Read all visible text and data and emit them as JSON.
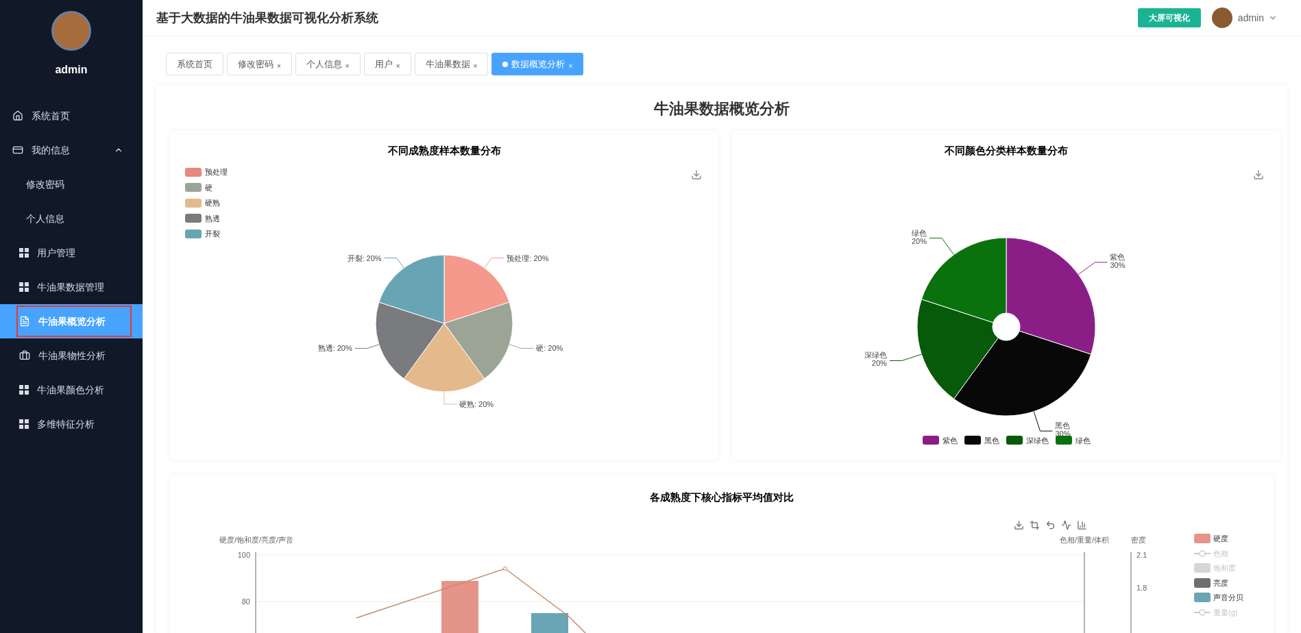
{
  "sidebar": {
    "user": "admin",
    "items": [
      {
        "label": "系统首页",
        "kind": "home",
        "selected": false
      },
      {
        "label": "我的信息",
        "kind": "wallet",
        "selected": false,
        "expanded": true,
        "children": [
          {
            "label": "修改密码",
            "selected": false
          },
          {
            "label": "个人信息",
            "selected": false
          }
        ]
      },
      {
        "label": "用户管理",
        "kind": "grid",
        "selected": false
      },
      {
        "label": "牛油果数据管理",
        "kind": "grid",
        "selected": false
      },
      {
        "label": "牛油果概览分析",
        "kind": "document",
        "selected": true
      },
      {
        "label": "牛油果物性分析",
        "kind": "briefcase",
        "selected": false
      },
      {
        "label": "牛油果颜色分析",
        "kind": "grid",
        "selected": false
      },
      {
        "label": "多维特征分析",
        "kind": "grid",
        "selected": false
      }
    ]
  },
  "header": {
    "title": "基于大数据的牛油果数据可视化分析系统",
    "screen_button": "大屏可视化",
    "user": "admin"
  },
  "tabs": [
    {
      "label": "系统首页",
      "selected": false
    },
    {
      "label": "修改密码",
      "selected": false,
      "close": "×"
    },
    {
      "label": "个人信息",
      "selected": false,
      "close": "×"
    },
    {
      "label": "用户",
      "selected": false,
      "close": "×"
    },
    {
      "label": "牛油果数据",
      "selected": false,
      "close": "×"
    },
    {
      "label": "数据概览分析",
      "selected": true,
      "close": "×"
    }
  ],
  "page_title": "牛油果数据概览分析",
  "ripeness_chart": {
    "legend": [
      {
        "label": "预处理",
        "color": "#e8877e"
      },
      {
        "label": "硬",
        "color": "#9ca595"
      },
      {
        "label": "硬熟",
        "color": "#e4b98c"
      },
      {
        "label": "熟透",
        "color": "#7a7b7f"
      },
      {
        "label": "开裂",
        "color": "#68a5b4"
      }
    ],
    "chart_data": {
      "type": "pie",
      "title": "不同成熟度样本数量分布",
      "series": [
        {
          "values": [
            20,
            20,
            20,
            20,
            20
          ]
        }
      ],
      "colors": [
        "#f4998b",
        "#9ca595",
        "#e4b98c",
        "#7a7b7f",
        "#68a5b4"
      ],
      "value_labels": [
        "预处理: 20%",
        "硬: 20%",
        "硬熟: 20%",
        "熟透: 20%",
        "开裂: 20%"
      ]
    }
  },
  "color_chart": {
    "legend": [
      {
        "label": "紫色",
        "color": "#8b1e86"
      },
      {
        "label": "黑色",
        "color": "#080808"
      },
      {
        "label": "深绿色",
        "color": "#065a0a"
      },
      {
        "label": "绿色",
        "color": "#0a720d"
      }
    ],
    "chart_data": {
      "type": "donut",
      "title": "不同颜色分类样本数量分布",
      "series": [
        {
          "values": [
            30,
            30,
            20,
            20
          ]
        }
      ],
      "colors": [
        "#8b1e86",
        "#080808",
        "#065a0a",
        "#0a720d"
      ],
      "value_labels": [
        "紫色\n30%",
        "黑色\n30%",
        "深绿色\n20%",
        "绿色\n20%"
      ]
    }
  },
  "metrics_chart": {
    "title": "各成熟度下核心指标平均值对比",
    "left_axis_name": "硬度/饱和度/亮度/声音",
    "right_axis_name": "色相/重量/体积",
    "density_axis_name": "密度",
    "left_ticks": [
      "100",
      "80"
    ],
    "density_ticks": [
      "2.1",
      "1.8"
    ],
    "legend": [
      {
        "label": "硬度",
        "kind": "bar",
        "color": "#e5948a",
        "disabled": false
      },
      {
        "label": "色相",
        "kind": "line",
        "color": "#cccccc",
        "disabled": true
      },
      {
        "label": "饱和度",
        "kind": "bar",
        "color": "#d6d6d6",
        "disabled": true
      },
      {
        "label": "亮度",
        "kind": "bar",
        "color": "#6e6e6e",
        "disabled": false
      },
      {
        "label": "声音分贝",
        "kind": "bar",
        "color": "#6aa5b5",
        "disabled": false
      },
      {
        "label": "重量(g)",
        "kind": "line",
        "color": "#cccccc",
        "disabled": true
      }
    ]
  }
}
